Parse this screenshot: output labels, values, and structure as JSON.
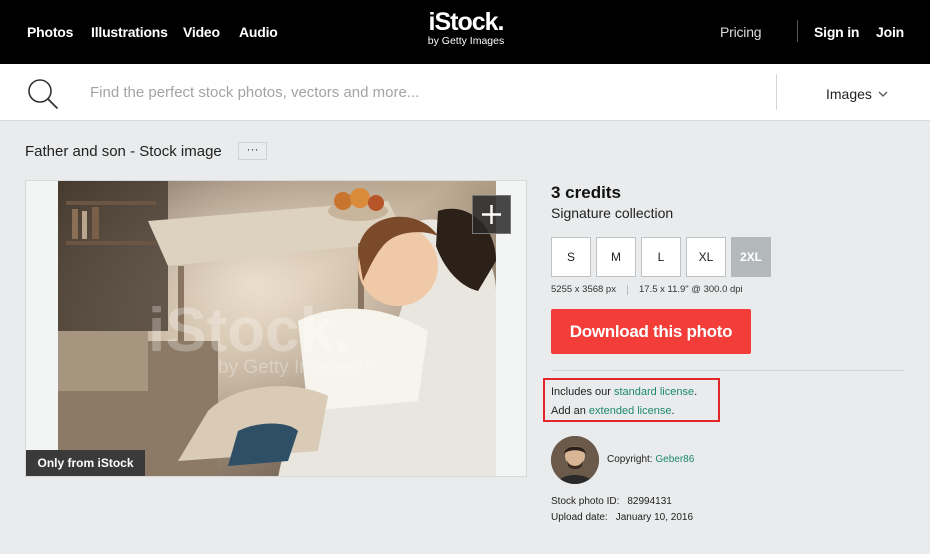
{
  "nav": {
    "left_links": [
      "Photos",
      "Illustrations",
      "Video",
      "Audio"
    ],
    "logo_brand": "iStock.",
    "logo_sub": "by Getty Images",
    "pricing": "Pricing",
    "sign_in": "Sign in",
    "join": "Join"
  },
  "search": {
    "placeholder": "Find the perfect stock photos, vectors and more...",
    "value": "",
    "type_selected": "Images",
    "icon": "search-icon"
  },
  "asset": {
    "title": "Father and son - Stock image",
    "more_label": "···",
    "badge": "Only from iStock",
    "watermark_brand": "iStock.",
    "watermark_sub": "by Getty Images™"
  },
  "purchase": {
    "credits": "3 credits",
    "collection": "Signature collection",
    "sizes": [
      "S",
      "M",
      "L",
      "XL",
      "2XL"
    ],
    "selected_size": "2XL",
    "pixel_dims": "5255 x 3568 px",
    "print_dims": "17.5 x 11.9\" @ 300.0 dpi",
    "download_label": "Download this photo"
  },
  "license": {
    "line1_prefix": "Includes our ",
    "line1_link": "standard license",
    "line1_suffix": ".",
    "line2_prefix": "Add an ",
    "line2_link": "extended license",
    "line2_suffix": "."
  },
  "contributor": {
    "copyright_label": "Copyright: ",
    "name": "Geber86"
  },
  "meta": {
    "id_label": "Stock photo ID:",
    "id_value": "82994131",
    "date_label": "Upload date:",
    "date_value": "January 10, 2016"
  },
  "colors": {
    "download_red": "#f23d38",
    "link_green": "#1d8a6a",
    "highlight_red": "#e3262a",
    "nav_black": "#000000"
  }
}
